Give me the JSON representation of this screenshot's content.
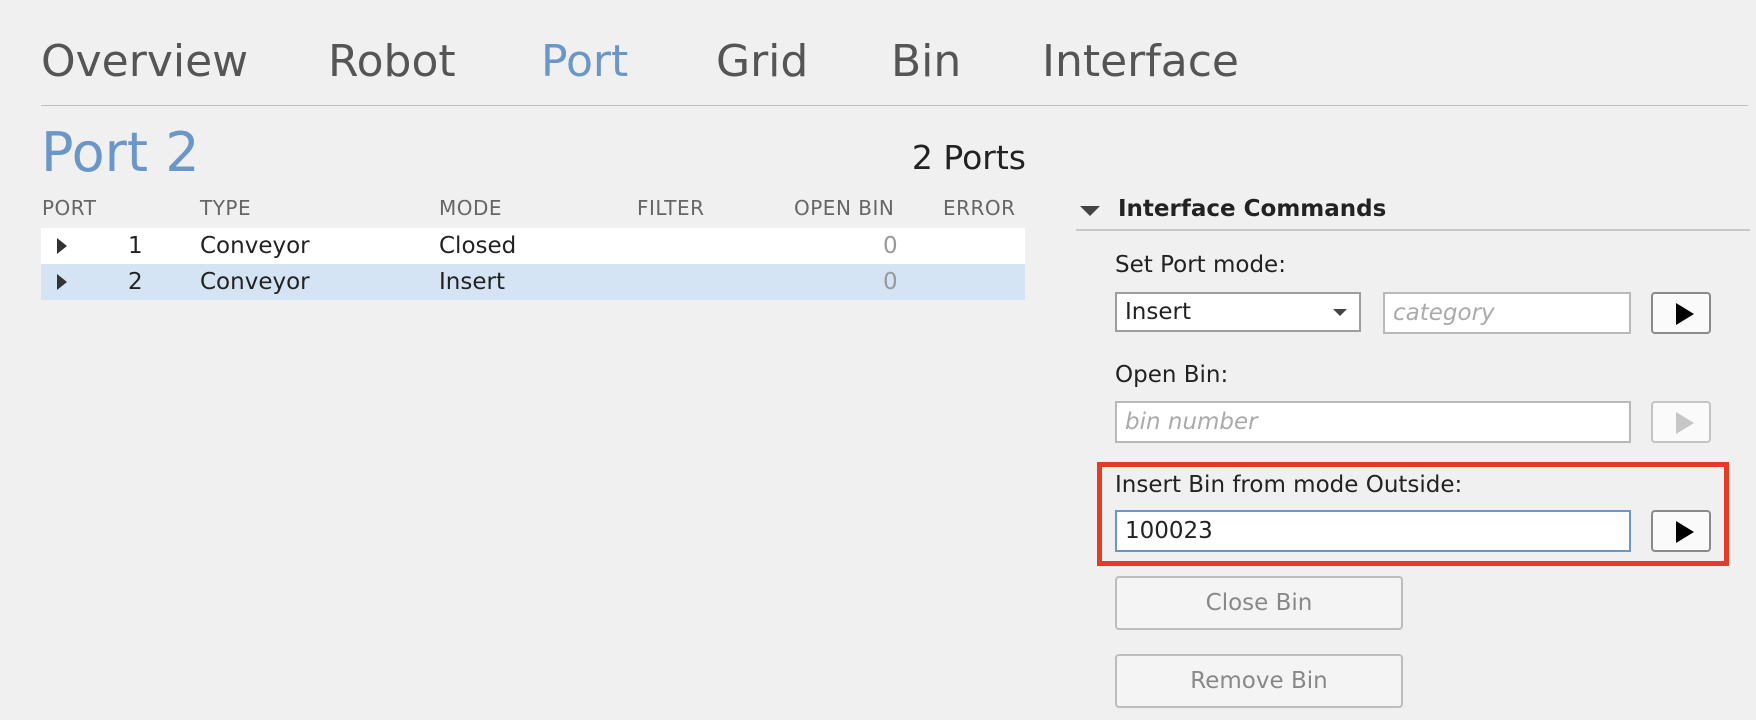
{
  "nav": {
    "tabs": [
      {
        "label": "Overview"
      },
      {
        "label": "Robot"
      },
      {
        "label": "Port",
        "active": true
      },
      {
        "label": "Grid"
      },
      {
        "label": "Bin"
      },
      {
        "label": "Interface"
      }
    ]
  },
  "header": {
    "title": "Port 2",
    "count": "2 Ports"
  },
  "table": {
    "columns": [
      "PORT",
      "TYPE",
      "MODE",
      "FILTER",
      "OPEN BIN",
      "ERROR"
    ],
    "rows": [
      {
        "port": "1",
        "type": "Conveyor",
        "mode": "Closed",
        "filter": "",
        "open_bin": "0",
        "error": ""
      },
      {
        "port": "2",
        "type": "Conveyor",
        "mode": "Insert",
        "filter": "",
        "open_bin": "0",
        "error": "",
        "selected": true
      }
    ]
  },
  "commands": {
    "title": "Interface Commands",
    "set_port_mode": {
      "label": "Set Port mode:",
      "selected": "Insert",
      "category_placeholder": "category"
    },
    "open_bin": {
      "label": "Open Bin:",
      "placeholder": "bin number"
    },
    "insert_bin": {
      "label": "Insert Bin from mode Outside:",
      "value": "100023"
    },
    "close_bin_label": "Close Bin",
    "remove_bin_label": "Remove Bin"
  },
  "colors": {
    "accent": "#6a97c8",
    "selected_row": "#d5e4f4",
    "highlight": "#e33b24"
  }
}
